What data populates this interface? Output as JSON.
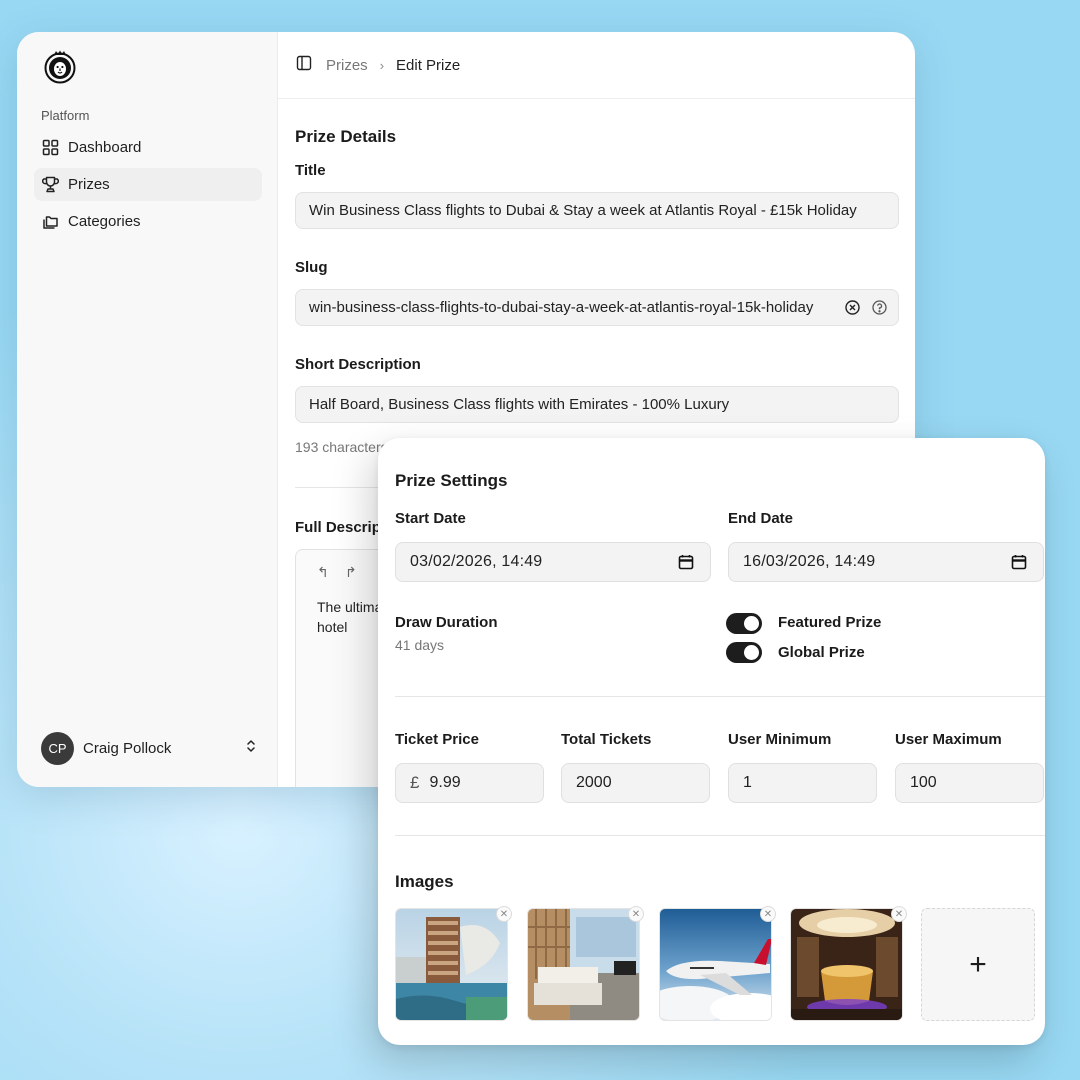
{
  "sidebar": {
    "group_label": "Platform",
    "items": [
      {
        "label": "Dashboard",
        "icon": "dashboard-grid-icon"
      },
      {
        "label": "Prizes",
        "icon": "trophy-icon",
        "active": true
      },
      {
        "label": "Categories",
        "icon": "folders-icon"
      }
    ],
    "user": {
      "initials": "CP",
      "name": "Craig Pollock"
    }
  },
  "breadcrumb": {
    "parent": "Prizes",
    "current": "Edit Prize"
  },
  "prize_details": {
    "section_title": "Prize Details",
    "title_label": "Title",
    "title_value": "Win Business Class flights to Dubai & Stay a week at Atlantis Royal - £15k Holiday",
    "slug_label": "Slug",
    "slug_value": "win-business-class-flights-to-dubai-stay-a-week-at-atlantis-royal-15k-holiday",
    "short_desc_label": "Short Description",
    "short_desc_value": "Half Board, Business Class flights with Emirates - 100% Luxury",
    "char_count": "193 characters",
    "full_desc_label": "Full Description",
    "full_desc_text": "The ultimate Dubai getaway, flying business class with Emirates and staying in a luxury hotel"
  },
  "prize_settings": {
    "section_title": "Prize Settings",
    "start_label": "Start Date",
    "start_value": "03/02/2026, 14:49",
    "end_label": "End Date",
    "end_value": "16/03/2026, 14:49",
    "draw_label": "Draw Duration",
    "draw_value": "41 days",
    "featured_label": "Featured Prize",
    "featured_on": true,
    "global_label": "Global Prize",
    "global_on": true,
    "ticket_price_label": "Ticket Price",
    "currency_symbol": "£",
    "ticket_price_value": "9.99",
    "total_tickets_label": "Total Tickets",
    "total_tickets_value": "2000",
    "user_min_label": "User Minimum",
    "user_min_value": "1",
    "user_max_label": "User Maximum",
    "user_max_value": "100",
    "images_label": "Images",
    "add_image_glyph": "+"
  },
  "colors": {
    "background": "#97d6f2",
    "toggle_on": "#1d1d1d",
    "field_bg": "#f3f3f3"
  }
}
